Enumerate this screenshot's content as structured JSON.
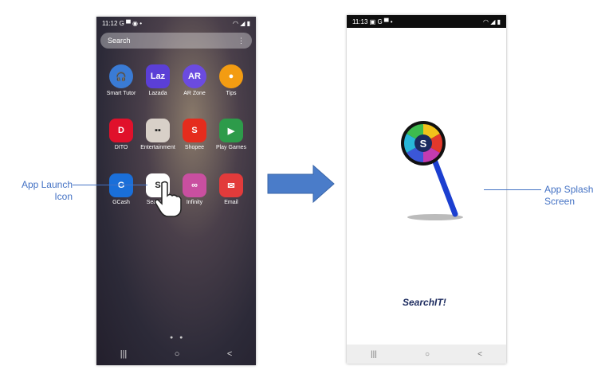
{
  "left_phone": {
    "status_time": "11:12",
    "status_icons_left": "G ▀ ◉ •",
    "status_icons_right": "◠ ◢ ▮",
    "search_placeholder": "Search",
    "search_menu_icon": "⋮",
    "apps": [
      {
        "label": "Smart Tutor",
        "glyph": "🎧",
        "color": "#3a7bd5"
      },
      {
        "label": "Lazada",
        "glyph": "Laz",
        "color": "#5b3fd6"
      },
      {
        "label": "AR Zone",
        "glyph": "AR",
        "color": "#6b4be0"
      },
      {
        "label": "Tips",
        "glyph": "●",
        "color": "#f39c12"
      },
      {
        "label": "DITO",
        "glyph": "D",
        "color": "#e0112b"
      },
      {
        "label": "Entertainment",
        "glyph": "▪▪",
        "color": "#d8d0c8"
      },
      {
        "label": "Shopee",
        "glyph": "S",
        "color": "#e52c1d"
      },
      {
        "label": "Play Games",
        "glyph": "▶",
        "color": "#2d9b4a"
      },
      {
        "label": "GCash",
        "glyph": "G",
        "color": "#1a6fd9"
      },
      {
        "label": "SearchIT",
        "glyph": "S",
        "color": "#ffffff"
      },
      {
        "label": "Infinity",
        "glyph": "∞",
        "color": "#c94fa0"
      },
      {
        "label": "Email",
        "glyph": "✉",
        "color": "#e23b3b"
      }
    ],
    "nav_buttons": [
      "|||",
      "○",
      "<"
    ]
  },
  "right_phone": {
    "status_time": "11:13",
    "status_icons_left": "▣ G ▀ •",
    "status_icons_right": "◠ ◢ ▮",
    "logo_letter": "S",
    "brand": "SearchIT!",
    "nav_buttons": [
      "|||",
      "○",
      "<"
    ]
  },
  "callouts": {
    "launch_line1": "App Launch",
    "launch_line2": "Icon",
    "splash_line1": "App Splash",
    "splash_line2": "Screen"
  },
  "colors": {
    "accent": "#4472c4",
    "arrow": "#4a7cc9"
  }
}
